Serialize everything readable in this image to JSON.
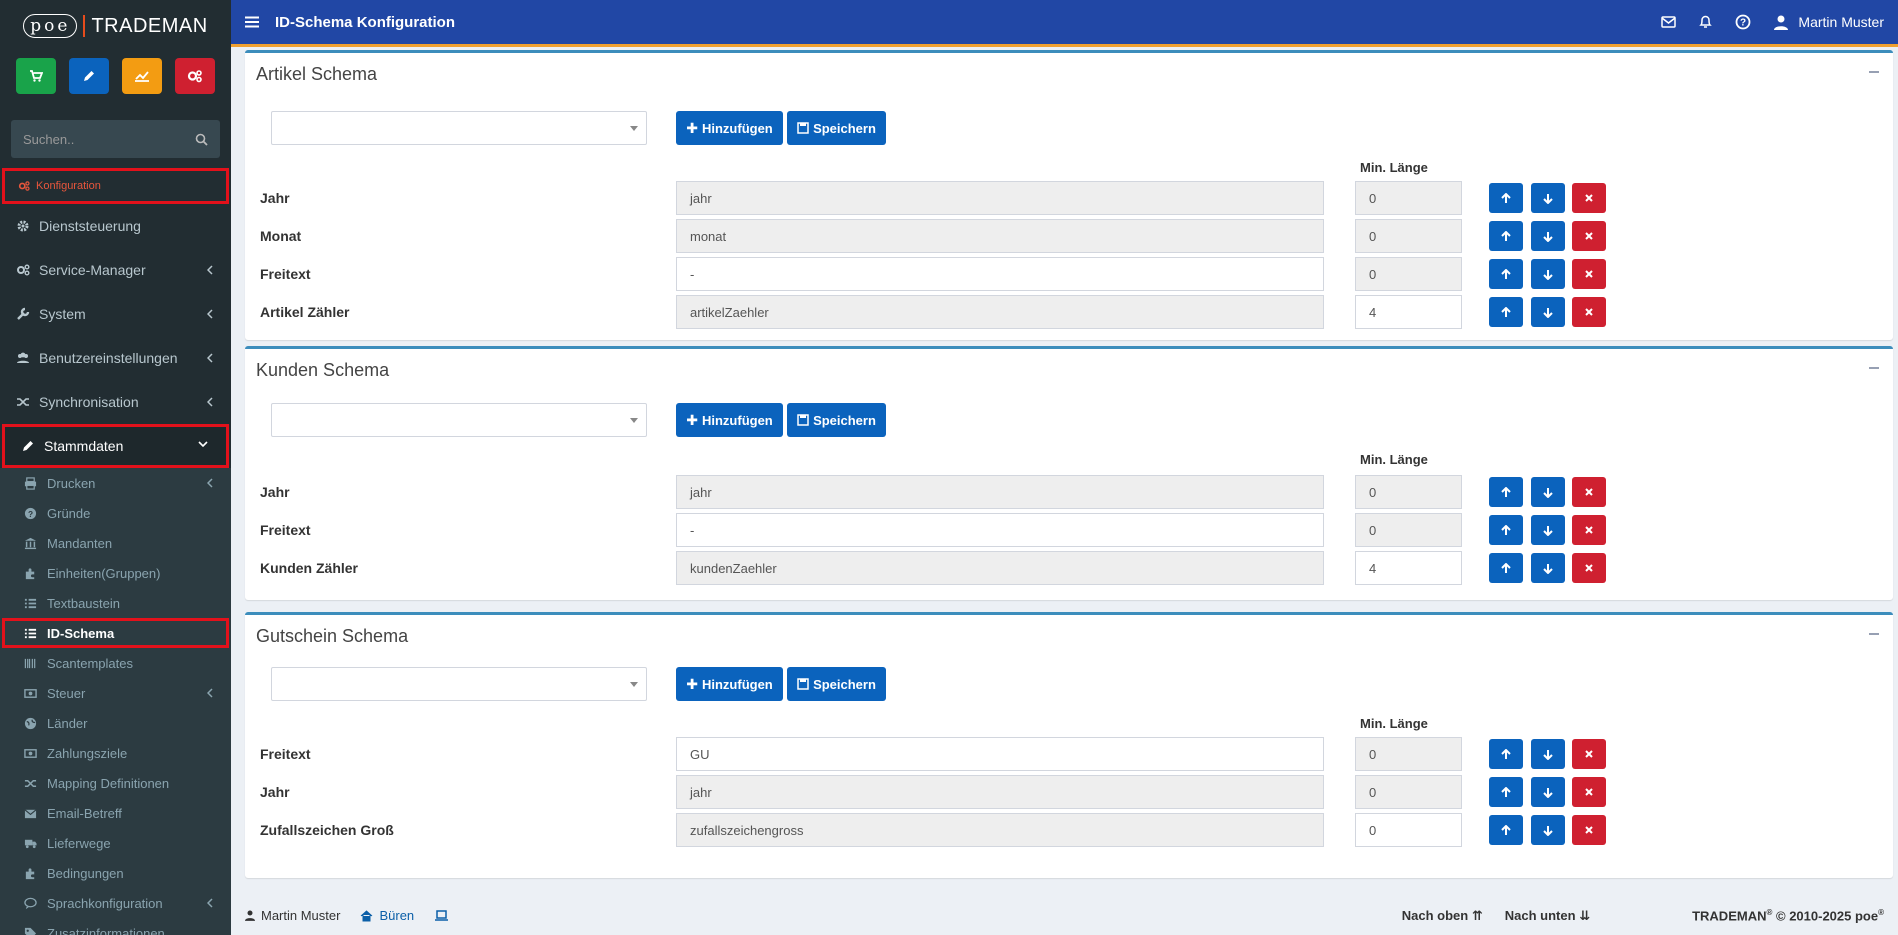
{
  "app": {
    "logo_poe": "poe",
    "logo_trademan": "TRADEMAN"
  },
  "sidebar": {
    "search_placeholder": "Suchen..",
    "konfiguration": "Konfiguration",
    "items": [
      {
        "label": "Dienststeuerung",
        "icon": "gear-icon"
      },
      {
        "label": "Service-Manager",
        "icon": "gears-icon"
      },
      {
        "label": "System",
        "icon": "wrench-icon"
      },
      {
        "label": "Benutzereinstellungen",
        "icon": "users-icon"
      },
      {
        "label": "Synchronisation",
        "icon": "shuffle-icon"
      },
      {
        "label": "Stammdaten",
        "icon": "pencil-icon"
      }
    ],
    "sub": [
      {
        "label": "Drucken",
        "icon": "print-icon"
      },
      {
        "label": "Gründe",
        "icon": "question-icon"
      },
      {
        "label": "Mandanten",
        "icon": "bank-icon"
      },
      {
        "label": "Einheiten(Gruppen)",
        "icon": "puzzle-icon"
      },
      {
        "label": "Textbaustein",
        "icon": "list-icon"
      },
      {
        "label": "ID-Schema",
        "icon": "list-icon"
      },
      {
        "label": "Scantemplates",
        "icon": "barcode-icon"
      },
      {
        "label": "Steuer",
        "icon": "money-icon"
      },
      {
        "label": "Länder",
        "icon": "globe-icon"
      },
      {
        "label": "Zahlungsziele",
        "icon": "money-icon"
      },
      {
        "label": "Mapping Definitionen",
        "icon": "shuffle-icon"
      },
      {
        "label": "Email-Betreff",
        "icon": "envelope-icon"
      },
      {
        "label": "Lieferwege",
        "icon": "truck-icon"
      },
      {
        "label": "Bedingungen",
        "icon": "puzzle-icon"
      },
      {
        "label": "Sprachkonfiguration",
        "icon": "comment-icon"
      },
      {
        "label": "Zusatzinformationen",
        "icon": "tags-icon"
      }
    ],
    "quick_colors": [
      "#19a34a",
      "#0b63bd",
      "#f39c12",
      "#cf2030"
    ]
  },
  "topbar": {
    "title": "ID-Schema Konfiguration",
    "user": "Martin Muster"
  },
  "labels": {
    "hinzufuegen": "Hinzufügen",
    "speichern": "Speichern",
    "min_laenge": "Min. Länge"
  },
  "artikel": {
    "title": "Artikel Schema",
    "rows": [
      {
        "label": "Jahr",
        "value": "jahr",
        "min": "0",
        "value_editable": false,
        "min_editable": false
      },
      {
        "label": "Monat",
        "value": "monat",
        "min": "0",
        "value_editable": false,
        "min_editable": false
      },
      {
        "label": "Freitext",
        "value": "-",
        "min": "0",
        "value_editable": true,
        "min_editable": false
      },
      {
        "label": "Artikel Zähler",
        "value": "artikelZaehler",
        "min": "4",
        "value_editable": false,
        "min_editable": true
      }
    ]
  },
  "kunden": {
    "title": "Kunden Schema",
    "rows": [
      {
        "label": "Jahr",
        "value": "jahr",
        "min": "0",
        "value_editable": false,
        "min_editable": false
      },
      {
        "label": "Freitext",
        "value": "-",
        "min": "0",
        "value_editable": true,
        "min_editable": false
      },
      {
        "label": "Kunden Zähler",
        "value": "kundenZaehler",
        "min": "4",
        "value_editable": false,
        "min_editable": true
      }
    ]
  },
  "gutschein": {
    "title": "Gutschein Schema",
    "rows": [
      {
        "label": "Freitext",
        "value": "GU",
        "min": "0",
        "value_editable": true,
        "min_editable": false
      },
      {
        "label": "Jahr",
        "value": "jahr",
        "min": "0",
        "value_editable": false,
        "min_editable": false
      },
      {
        "label": "Zufallszeichen Groß",
        "value": "zufallszeichengross",
        "min": "0",
        "value_editable": false,
        "min_editable": true
      }
    ]
  },
  "footer": {
    "user": "Martin Muster",
    "location": "Büren",
    "nach_oben": "Nach oben",
    "nach_unten": "Nach unten",
    "brand": "TRADEMAN",
    "reg": "®",
    "copyright": " © 2010-2025 poe",
    "reg2": "®"
  }
}
